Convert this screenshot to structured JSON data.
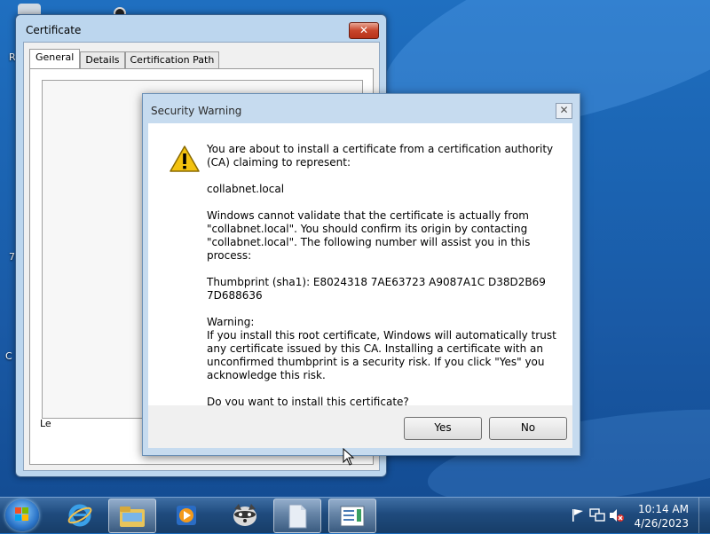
{
  "desktop": {
    "icon_letters": [
      "R",
      "7",
      "C"
    ]
  },
  "certificate_window": {
    "title": "Certificate",
    "close_glyph": "✕",
    "tabs": [
      {
        "label": "General",
        "active": true
      },
      {
        "label": "Details",
        "active": false
      },
      {
        "label": "Certification Path",
        "active": false
      }
    ],
    "partial_label": "Le"
  },
  "security_warning": {
    "title": "Security Warning",
    "close_glyph": "✕",
    "icon": "warning-triangle-icon",
    "paragraphs": [
      "You are about to install a certificate from a certification authority (CA) claiming to represent:",
      "collabnet.local",
      "Windows cannot validate that the certificate is actually from \"collabnet.local\". You should confirm its origin by contacting \"collabnet.local\". The following number will assist you in this process:",
      "Thumbprint (sha1): E8024318 7AE63723 A9087A1C D38D2B69 7D688636",
      "Warning:\nIf you install this root certificate, Windows will automatically trust any certificate issued by this CA. Installing a certificate with an unconfirmed thumbprint is a security risk. If you click \"Yes\" you acknowledge this risk.",
      "Do you want to install this certificate?"
    ],
    "buttons": {
      "yes": "Yes",
      "no": "No"
    }
  },
  "taskbar": {
    "items": [
      "start-orb-icon",
      "internet-explorer-icon",
      "file-explorer-icon",
      "media-player-icon",
      "raccoon-app-icon",
      "document-icon",
      "certificate-manager-icon"
    ],
    "tray_icons": [
      "flag-icon",
      "network-icon",
      "volume-muted-icon"
    ],
    "clock": {
      "time": "10:14 AM",
      "date": "4/26/2023"
    }
  },
  "colors": {
    "accent": "#1f6fc0",
    "warning_yellow": "#f3c20f",
    "close_red": "#c8452b"
  }
}
